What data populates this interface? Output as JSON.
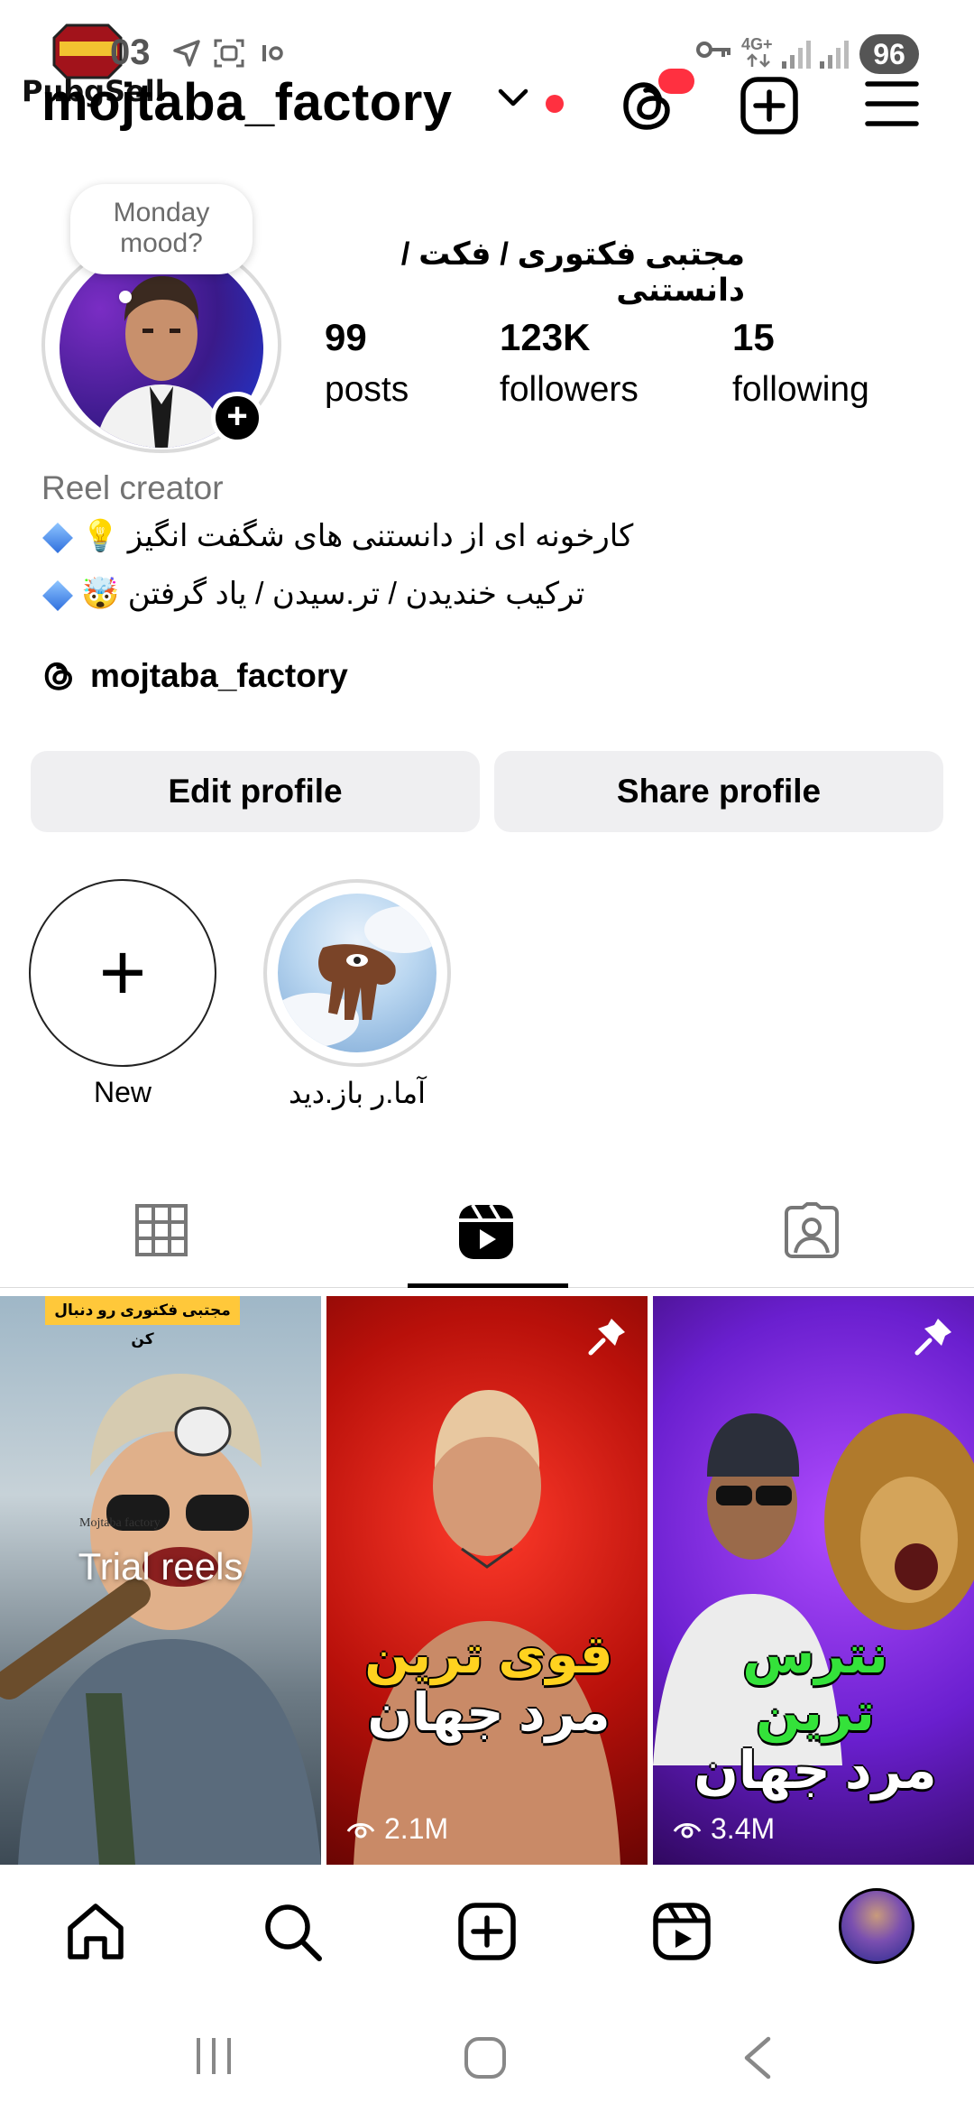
{
  "status_bar": {
    "time": "03",
    "network": "4G+",
    "battery": "96",
    "watermark_text": "PubgSell"
  },
  "header": {
    "username": "mojtaba_factory"
  },
  "profile": {
    "note": "Monday mood?",
    "display_name": "مجتبی فکتوری / فکت / دانستنی",
    "stats": [
      {
        "value": "99",
        "label": "posts"
      },
      {
        "value": "123K",
        "label": "followers"
      },
      {
        "value": "15",
        "label": "following"
      }
    ],
    "category": "Reel creator",
    "bio_lines": [
      "کارخونه ای از دانستنی های شگفت انگیز 💡",
      "ترکیب خندیدن / تر.سیدن / یاد گرفتن 🤯"
    ],
    "threads_handle": "mojtaba_factory"
  },
  "buttons": {
    "edit_profile": "Edit profile",
    "share_profile": "Share profile"
  },
  "highlights": [
    {
      "label": "New"
    },
    {
      "label": "آما.ر باز.دید"
    }
  ],
  "tabs": [
    {
      "icon": "grid-icon"
    },
    {
      "icon": "reels-icon",
      "active": true
    },
    {
      "icon": "tagged-icon"
    }
  ],
  "grid": [
    {
      "banner": "مجتبی فکتوری رو دنبال کن",
      "watermark": "Mojtaba factory",
      "overlay": "Trial reels"
    },
    {
      "headline_1": "قوی ترین",
      "headline_2": "مرد جهان",
      "views": "2.1M",
      "pinned": true,
      "accent": "#ffd21f"
    },
    {
      "headline_1": "نترس ترین",
      "headline_2": "مرد جهان",
      "views": "3.4M",
      "pinned": true,
      "accent": "#34e23a"
    }
  ],
  "bottom_nav": [
    "home-icon",
    "search-icon",
    "create-icon",
    "reels-icon",
    "profile-avatar"
  ],
  "colors": {
    "notification_red": "#ff3040",
    "button_bg": "#efeff1",
    "muted_text": "#737373"
  }
}
